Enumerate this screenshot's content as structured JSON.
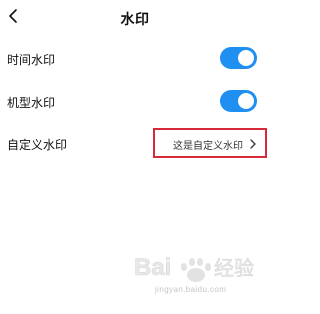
{
  "header": {
    "title": "水印",
    "back_icon": "chevron-left-icon"
  },
  "settings": [
    {
      "label": "时间水印",
      "type": "toggle",
      "enabled": true
    },
    {
      "label": "机型水印",
      "type": "toggle",
      "enabled": true
    },
    {
      "label": "自定义水印",
      "type": "value",
      "value": "这是自定义水印"
    }
  ],
  "colors": {
    "toggle_on": "#1f8ff2",
    "highlight_border": "#d9283a"
  },
  "watermark": {
    "logo": "Baidu 经验",
    "url": "jingyan.baidu.com"
  }
}
